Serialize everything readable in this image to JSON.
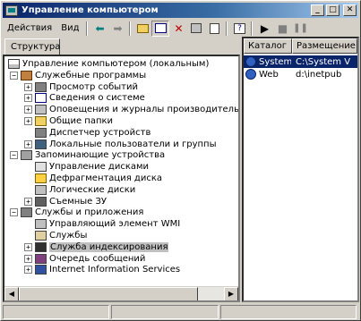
{
  "window": {
    "title": "Управление компьютером",
    "minimize_glyph": "_",
    "maximize_glyph": "□",
    "close_glyph": "✕"
  },
  "menu": {
    "action": "Действия",
    "view": "Вид"
  },
  "toolbar": {
    "back_icon": "arrow-left-icon",
    "forward_icon": "arrow-right-icon",
    "up_icon": "folder-up-icon",
    "showhide_tree_icon": "console-tree-icon",
    "delete_icon": "delete-icon",
    "properties_icon": "properties-icon",
    "export_icon": "export-list-icon",
    "help_icon": "help-icon",
    "start_icon": "play-icon",
    "stop_icon": "stop-icon",
    "pause_icon": "pause-icon"
  },
  "left": {
    "tab": "Структура",
    "tree": [
      {
        "label": "Управление компьютером (локальным)",
        "level": 0,
        "expander": "",
        "icon": "computer",
        "has_expander": false
      },
      {
        "label": "Служебные программы",
        "level": 1,
        "expander": "−",
        "icon": "tools",
        "has_expander": true
      },
      {
        "label": "Просмотр событий",
        "level": 2,
        "expander": "+",
        "icon": "events",
        "has_expander": true
      },
      {
        "label": "Сведения о системе",
        "level": 2,
        "expander": "+",
        "icon": "info",
        "has_expander": true
      },
      {
        "label": "Оповещения и журналы производительности",
        "level": 2,
        "expander": "+",
        "icon": "alert",
        "has_expander": true
      },
      {
        "label": "Общие папки",
        "level": 2,
        "expander": "+",
        "icon": "folder",
        "has_expander": true
      },
      {
        "label": "Диспетчер устройств",
        "level": 2,
        "expander": "",
        "icon": "devices",
        "has_expander": false
      },
      {
        "label": "Локальные пользователи и группы",
        "level": 2,
        "expander": "+",
        "icon": "users",
        "has_expander": true
      },
      {
        "label": "Запоминающие устройства",
        "level": 1,
        "expander": "−",
        "icon": "storage",
        "has_expander": true
      },
      {
        "label": "Управление дисками",
        "level": 2,
        "expander": "",
        "icon": "disk",
        "has_expander": false
      },
      {
        "label": "Дефрагментация диска",
        "level": 2,
        "expander": "",
        "icon": "defrag",
        "has_expander": false
      },
      {
        "label": "Логические диски",
        "level": 2,
        "expander": "",
        "icon": "logical",
        "has_expander": false
      },
      {
        "label": "Съемные ЗУ",
        "level": 2,
        "expander": "+",
        "icon": "removable",
        "has_expander": true
      },
      {
        "label": "Службы и приложения",
        "level": 1,
        "expander": "−",
        "icon": "services",
        "has_expander": true
      },
      {
        "label": "Управляющий элемент WMI",
        "level": 2,
        "expander": "",
        "icon": "wmi",
        "has_expander": false
      },
      {
        "label": "Службы",
        "level": 2,
        "expander": "",
        "icon": "svc",
        "has_expander": false
      },
      {
        "label": "Служба индексирования",
        "level": 2,
        "expander": "+",
        "icon": "index",
        "has_expander": true,
        "selected": true
      },
      {
        "label": "Очередь сообщений",
        "level": 2,
        "expander": "+",
        "icon": "queue",
        "has_expander": true
      },
      {
        "label": "Internet Information Services",
        "level": 2,
        "expander": "+",
        "icon": "iis",
        "has_expander": true
      }
    ]
  },
  "right": {
    "columns": [
      "Каталог",
      "Размещение"
    ],
    "rows": [
      {
        "name": "System",
        "location": "C:\\System V",
        "selected": true
      },
      {
        "name": "Web",
        "location": "d:\\inetpub",
        "selected": false
      }
    ]
  },
  "colors": {
    "titlebar_start": "#0a246a",
    "selection": "#0a246a",
    "face": "#d4d0c8"
  }
}
